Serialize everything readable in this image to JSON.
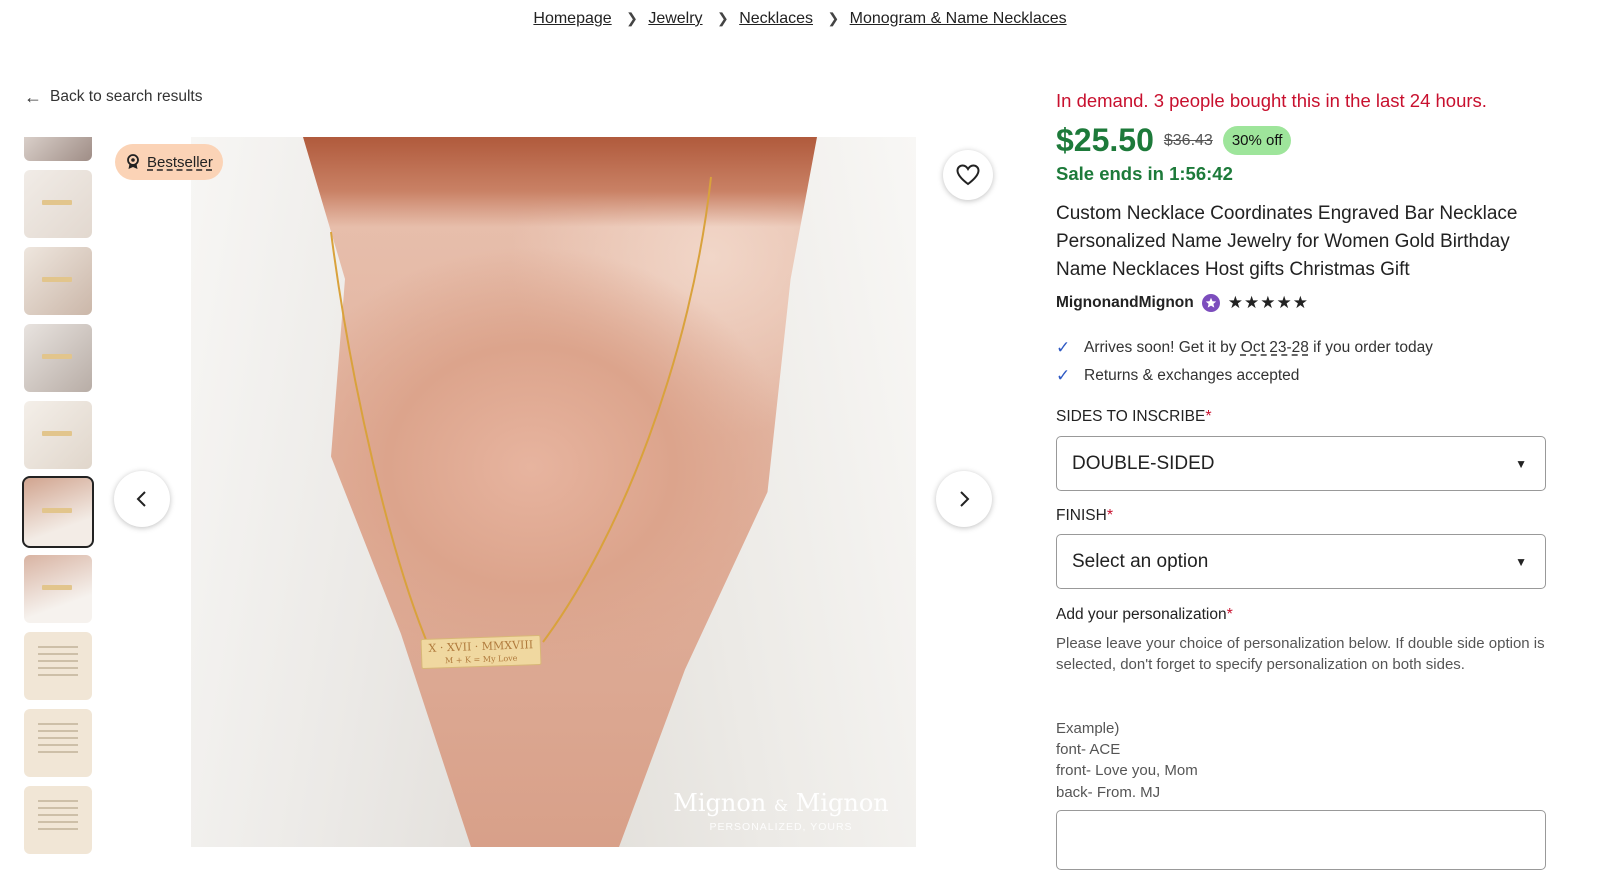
{
  "breadcrumb": [
    {
      "label": "Homepage"
    },
    {
      "label": "Jewelry"
    },
    {
      "label": "Necklaces"
    },
    {
      "label": "Monogram & Name Necklaces"
    }
  ],
  "back_link": "Back to search results",
  "badge": "Bestseller",
  "gallery": {
    "thumb_count": 10,
    "selected_index": 5,
    "pendant_line1": "X · XVII · MMXVIII",
    "pendant_line2": "M + K  = My Love",
    "watermark_brand_left": "Mignon",
    "watermark_amp": "&",
    "watermark_brand_right": "Mignon",
    "watermark_tagline": "PERSONALIZED, YOURS"
  },
  "product": {
    "demand": "In demand. 3 people bought this in the last 24 hours.",
    "price": "$25.50",
    "original_price": "$36.43",
    "discount": "30% off",
    "sale_ends": "Sale ends in 1:56:42",
    "title": "Custom Necklace Coordinates Engraved Bar Necklace Personalized Name Jewelry for Women Gold Birthday Name Necklaces Host gifts Christmas Gift",
    "shop_name": "MignonandMignon",
    "rating_stars": "★★★★★",
    "rating": 5,
    "arrives_prefix": "Arrives soon! Get it by",
    "arrives_date": "Oct 23-28",
    "arrives_suffix": "if you order today",
    "returns": "Returns & exchanges accepted"
  },
  "options": {
    "sides_label": "SIDES TO INSCRIBE",
    "sides_value": "DOUBLE-SIDED",
    "finish_label": "FINISH",
    "finish_value": "Select an option",
    "required_mark": "*"
  },
  "personalization": {
    "label": "Add your personalization",
    "help": "Please leave your choice of personalization below. If double side option is selected, don't forget to specify personalization on both sides.",
    "example_lines": [
      "Example)",
      "font- ACE",
      "front- Love you, Mom",
      "back- From. MJ"
    ]
  },
  "colors": {
    "demand_red": "#c8102e",
    "price_green": "#1d7a3a",
    "discount_bg": "#9ee59b",
    "bestseller_bg": "#fbd3b6",
    "check_blue": "#2f5ac4",
    "star_seller_purple": "#7c4dbd"
  },
  "icons": {
    "back": "arrow-left-icon",
    "prev": "chevron-left-icon",
    "next": "chevron-right-icon",
    "favorite": "heart-icon",
    "bestseller": "award-icon",
    "check": "check-icon",
    "star_seller": "star-seller-icon",
    "caret": "caret-down-icon"
  }
}
